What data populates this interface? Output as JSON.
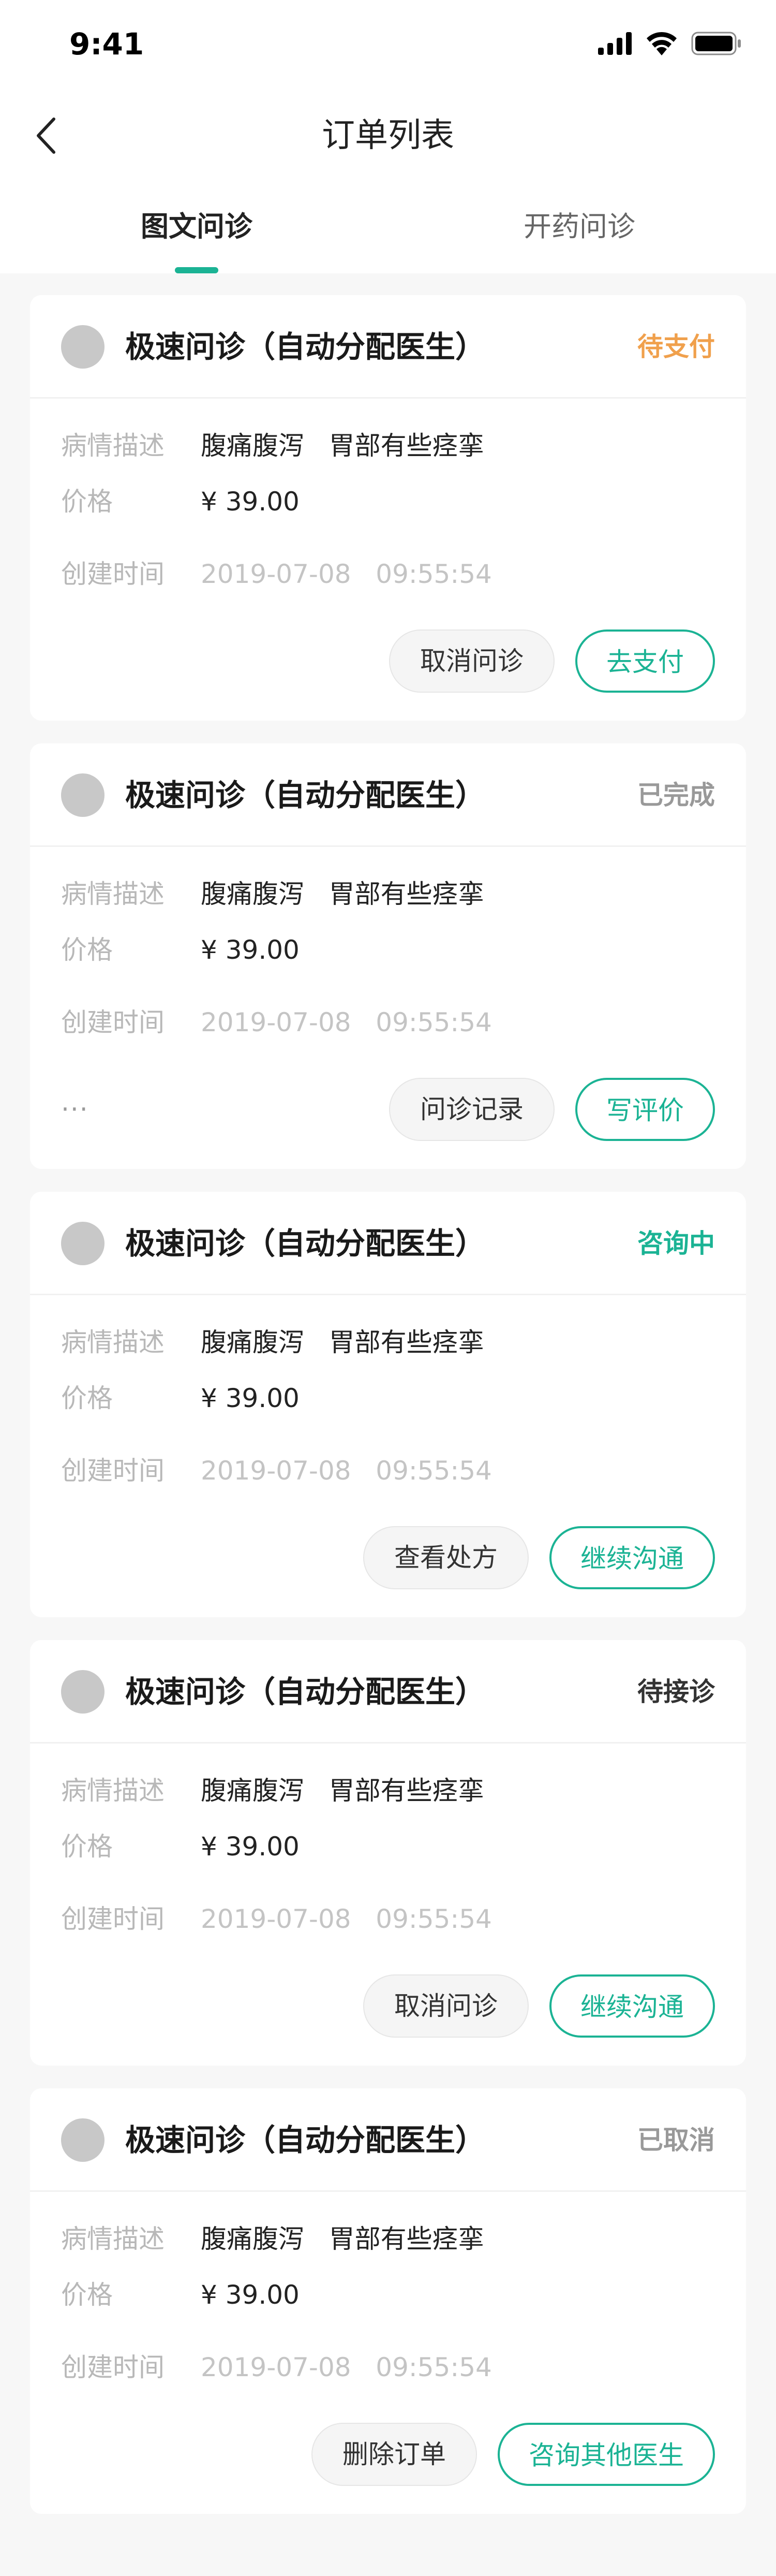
{
  "status_bar": {
    "time": "9:41"
  },
  "nav": {
    "title": "订单列表"
  },
  "tabs": [
    {
      "label": "图文问诊",
      "active": true
    },
    {
      "label": "开药问诊",
      "active": false
    }
  ],
  "labels": {
    "condition": "病情描述",
    "price": "价格",
    "created": "创建时间"
  },
  "colors": {
    "accent": "#1bb394",
    "orange": "#f0a04c",
    "grey_status": "#999999",
    "dark_status": "#333333"
  },
  "orders": [
    {
      "title": "极速问诊（自动分配医生）",
      "status": "待支付",
      "status_color": "#f0a04c",
      "condition": "腹痛腹泻   胃部有些痉挛",
      "price": "¥ 39.00",
      "created": "2019-07-08   09:55:54",
      "buttons": [
        {
          "label": "取消问诊",
          "style": "grey"
        },
        {
          "label": "去支付",
          "style": "green"
        }
      ]
    },
    {
      "title": "极速问诊（自动分配医生）",
      "status": "已完成",
      "status_color": "#999999",
      "condition": "腹痛腹泻   胃部有些痉挛",
      "price": "¥ 39.00",
      "created": "2019-07-08   09:55:54",
      "more": "···",
      "buttons": [
        {
          "label": "问诊记录",
          "style": "grey"
        },
        {
          "label": "写评价",
          "style": "green"
        }
      ]
    },
    {
      "title": "极速问诊（自动分配医生）",
      "status": "咨询中",
      "status_color": "#1bb394",
      "condition": "腹痛腹泻   胃部有些痉挛",
      "price": "¥ 39.00",
      "created": "2019-07-08   09:55:54",
      "buttons": [
        {
          "label": "查看处方",
          "style": "grey"
        },
        {
          "label": "继续沟通",
          "style": "green"
        }
      ]
    },
    {
      "title": "极速问诊（自动分配医生）",
      "status": "待接诊",
      "status_color": "#333333",
      "condition": "腹痛腹泻   胃部有些痉挛",
      "price": "¥ 39.00",
      "created": "2019-07-08   09:55:54",
      "buttons": [
        {
          "label": "取消问诊",
          "style": "grey"
        },
        {
          "label": "继续沟通",
          "style": "green"
        }
      ]
    },
    {
      "title": "极速问诊（自动分配医生）",
      "status": "已取消",
      "status_color": "#999999",
      "condition": "腹痛腹泻   胃部有些痉挛",
      "price": "¥ 39.00",
      "created": "2019-07-08   09:55:54",
      "buttons": [
        {
          "label": "删除订单",
          "style": "grey"
        },
        {
          "label": "咨询其他医生",
          "style": "green"
        }
      ]
    }
  ]
}
